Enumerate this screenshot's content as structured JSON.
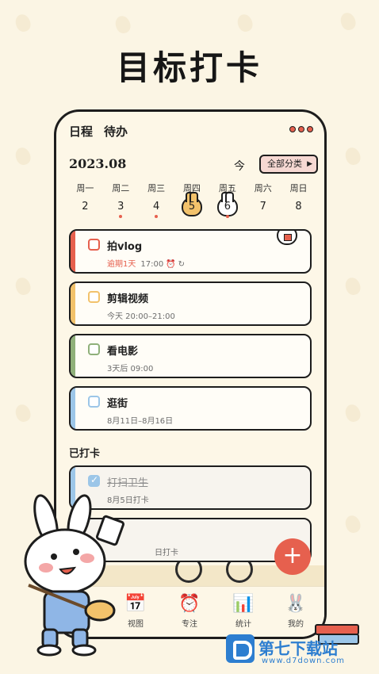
{
  "headline": "目标打卡",
  "app": {
    "tabs": [
      {
        "label": "日程",
        "active": true
      },
      {
        "label": "待办",
        "active": false
      }
    ],
    "month": "2023.08",
    "today_label": "今",
    "filter_label": "全部分类",
    "weekdays": [
      "周一",
      "周二",
      "周三",
      "周四",
      "周五",
      "周六",
      "周日"
    ],
    "days": [
      "2",
      "3",
      "4",
      "5",
      "6",
      "7",
      "8"
    ],
    "tasks": [
      {
        "title": "拍vlog",
        "overdue": "逾期1天",
        "time": "17:00",
        "color": "#e6604e"
      },
      {
        "title": "剪辑视频",
        "time": "今天 20:00–21:00",
        "color": "#f2c26b"
      },
      {
        "title": "看电影",
        "time": "3天后 09:00",
        "color": "#8fb07a"
      },
      {
        "title": "逛街",
        "time": "8月11日–8月16日",
        "color": "#9cc6e8"
      }
    ],
    "done_label": "已打卡",
    "done_tasks": [
      {
        "title": "打扫卫生",
        "time": "8月5日打卡"
      },
      {
        "title": "",
        "time": "日打卡"
      }
    ],
    "fab_label": "+",
    "nav": [
      {
        "label": "视图",
        "icon": "calendar-icon"
      },
      {
        "label": "专注",
        "icon": "alarm-clock-icon"
      },
      {
        "label": "统计",
        "icon": "bar-chart-icon"
      },
      {
        "label": "我的",
        "icon": "bunny-icon"
      }
    ]
  },
  "watermark": {
    "name": "第七下载站",
    "url": "www.d7down.com"
  }
}
